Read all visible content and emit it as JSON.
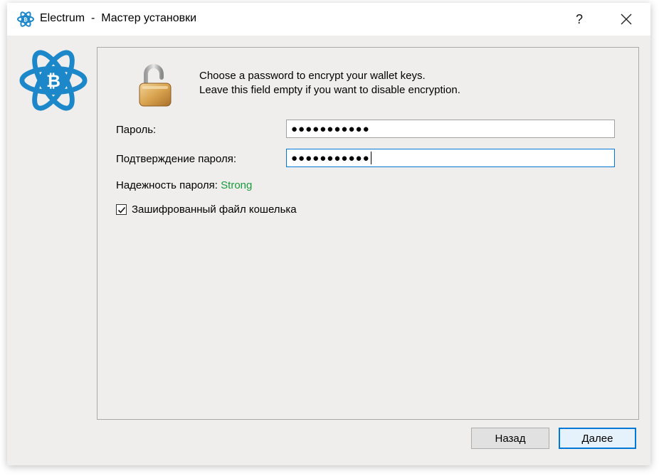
{
  "window": {
    "title": "Electrum  -  Мастер установки",
    "help_label": "?",
    "close_icon": "close-icon",
    "app_icon": "electrum-logo-icon"
  },
  "info": {
    "line1": "Choose a password to encrypt your wallet keys.",
    "line2": "Leave this field empty if you want to disable encryption.",
    "icon": "unlocked-padlock-icon"
  },
  "form": {
    "password_label": "Пароль:",
    "password_value": "●●●●●●●●●●●",
    "confirm_label": "Подтверждение пароля:",
    "confirm_value": "●●●●●●●●●●●",
    "strength_label": "Надежность пароля:",
    "strength_value": "Strong",
    "encrypt_checkbox_label": "Зашифрованный файл кошелька",
    "encrypt_checked": true
  },
  "buttons": {
    "back": "Назад",
    "next": "Далее"
  },
  "colors": {
    "accent": "#0078d7",
    "electrum_blue": "#1c87c9",
    "strength_green": "#179c3a"
  }
}
